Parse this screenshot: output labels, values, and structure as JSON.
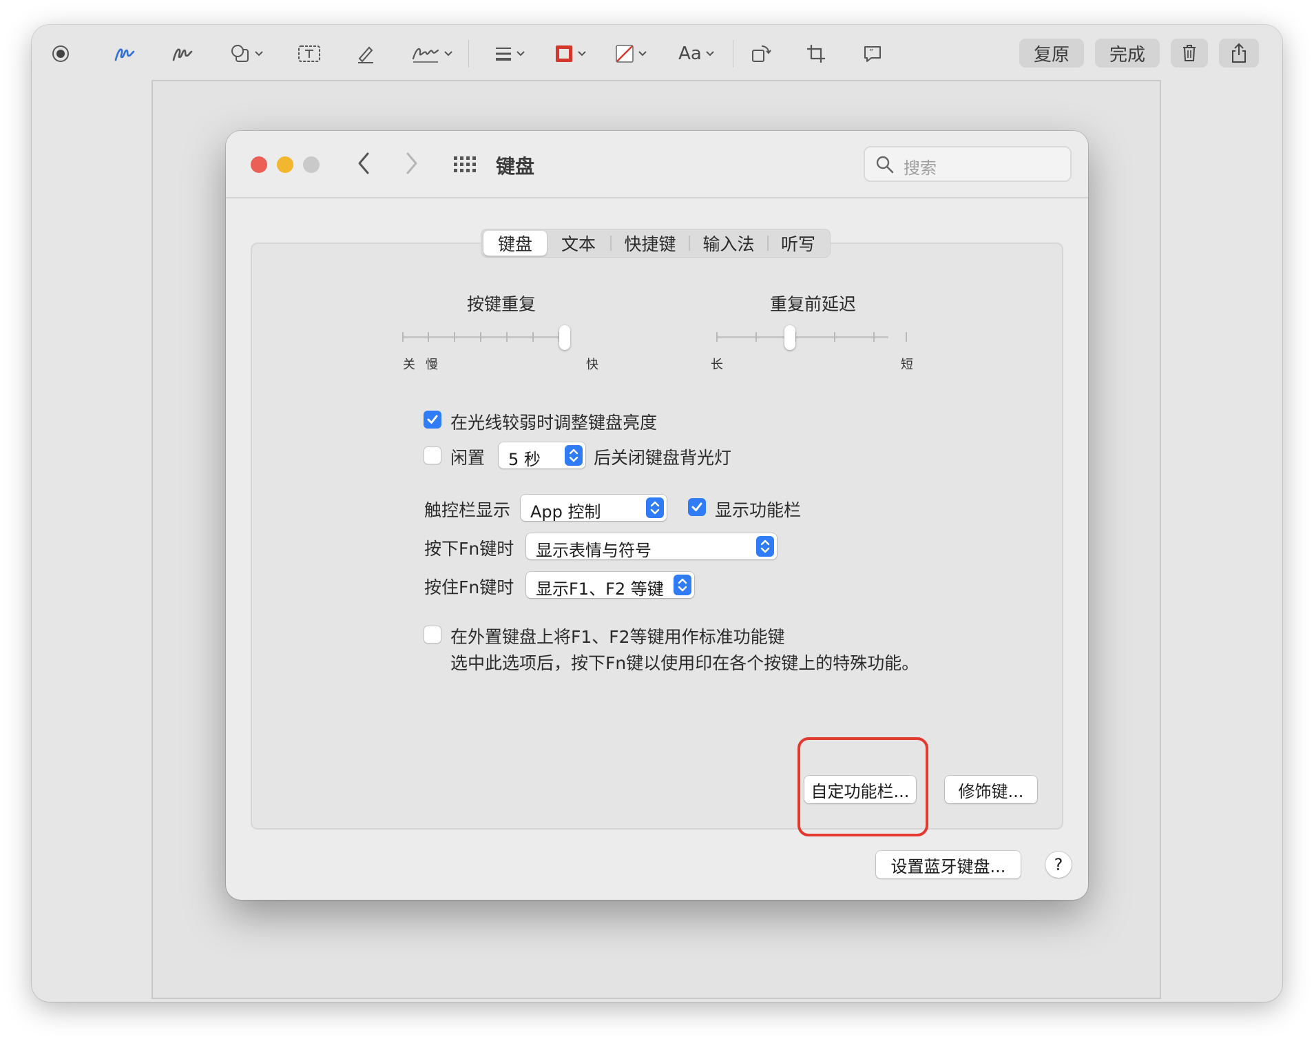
{
  "markup_toolbar": {
    "text_style_label": "Aa",
    "revert_label": "复原",
    "done_label": "完成",
    "colors": {
      "border": "#d4372b",
      "accent": "#2f6fd6"
    }
  },
  "prefs_window": {
    "title": "键盘",
    "search_placeholder": "搜索",
    "tabs": [
      {
        "label": "键盘",
        "active": true
      },
      {
        "label": "文本",
        "active": false
      },
      {
        "label": "快捷键",
        "active": false
      },
      {
        "label": "输入法",
        "active": false
      },
      {
        "label": "听写",
        "active": false
      }
    ],
    "key_repeat": {
      "label": "按键重复",
      "min_label_off": "关",
      "min_label_slow": "慢",
      "max_label": "快",
      "value": 6,
      "ticks": 8
    },
    "delay_until_repeat": {
      "label": "重复前延迟",
      "min_label": "长",
      "max_label": "短",
      "value": 2,
      "ticks": 6
    },
    "adjust_brightness": {
      "label": "在光线较弱时调整键盘亮度",
      "checked": true
    },
    "idle_backlight": {
      "prefix": "闲置",
      "value": "5 秒",
      "suffix": "后关闭键盘背光灯",
      "checked": false
    },
    "touch_bar": {
      "label": "触控栏显示",
      "value": "App 控制",
      "show_control_strip": {
        "label": "显示功能栏",
        "checked": true
      }
    },
    "press_fn": {
      "label": "按下Fn键时",
      "value": "显示表情与符号"
    },
    "hold_fn": {
      "label": "按住Fn键时",
      "value": "显示F1、F2 等键"
    },
    "use_f_keys": {
      "label": "在外置键盘上将F1、F2等键用作标准功能键",
      "description": "选中此选项后，按下Fn键以使用印在各个按键上的特殊功能。",
      "checked": false
    },
    "customize_control_strip_label": "自定功能栏...",
    "modifier_keys_label": "修饰键...",
    "setup_bluetooth_label": "设置蓝牙键盘...",
    "help_label": "?"
  }
}
